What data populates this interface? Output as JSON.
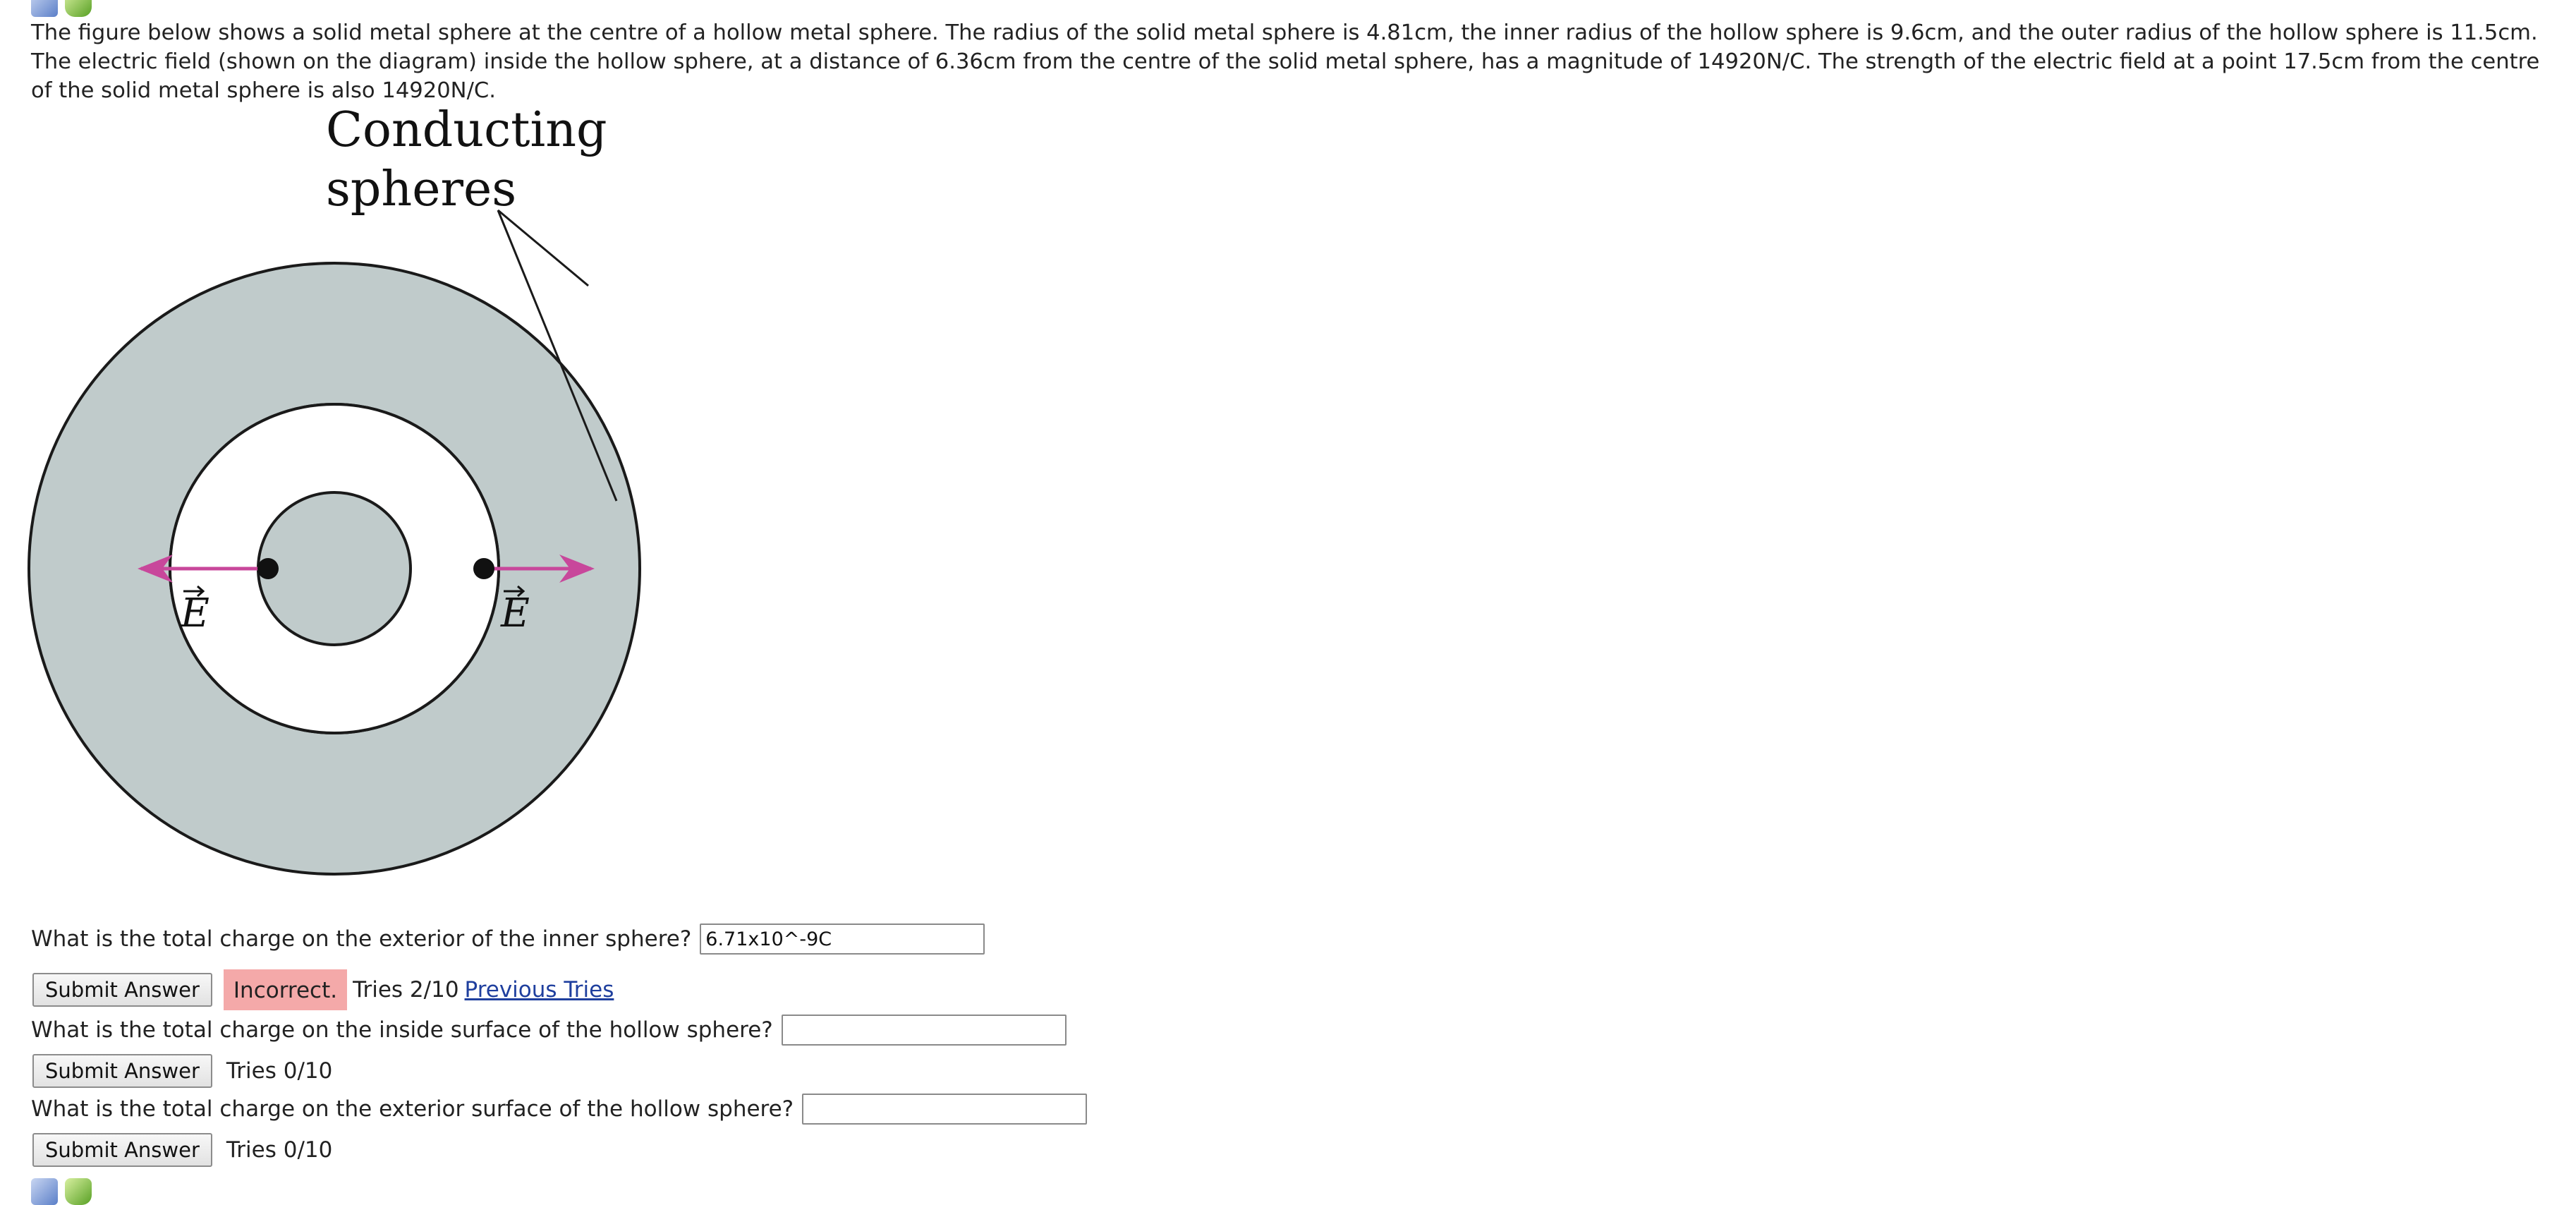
{
  "problem": {
    "text": "The figure below shows a solid metal sphere at the centre of a hollow metal sphere. The radius of the solid metal sphere is 4.81cm, the inner radius of the hollow sphere is 9.6cm, and the outer radius of the hollow sphere is 11.5cm. The electric field (shown on the diagram) inside the hollow sphere, at a distance of 6.36cm from the centre of the solid metal sphere, has a magnitude of 14920N/C. The strength of the electric field at a point 17.5cm from the centre of the solid metal sphere is also 14920N/C."
  },
  "figure": {
    "label_line1": "Conducting",
    "label_line2": "spheres",
    "field_label_outer": "E",
    "field_label_inner": "E",
    "colors": {
      "shell_fill": "#c0cbcb",
      "arrow": "#c8479b",
      "outline": "#1a1a1a"
    }
  },
  "questions": [
    {
      "text": "What is the total charge on the exterior of the inner sphere?",
      "value": "6.71x10^-9C",
      "button": "Submit Answer",
      "status": "Incorrect.",
      "tries": "Tries 2/10",
      "link": "Previous Tries"
    },
    {
      "text": "What is the total charge on the inside surface of the hollow sphere?",
      "value": "",
      "button": "Submit Answer",
      "tries": "Tries 0/10"
    },
    {
      "text": "What is the total charge on the exterior surface of the hollow sphere?",
      "value": "",
      "button": "Submit Answer",
      "tries": "Tries 0/10"
    }
  ],
  "icons": [
    "edit-note-icon",
    "bucket-icon"
  ]
}
